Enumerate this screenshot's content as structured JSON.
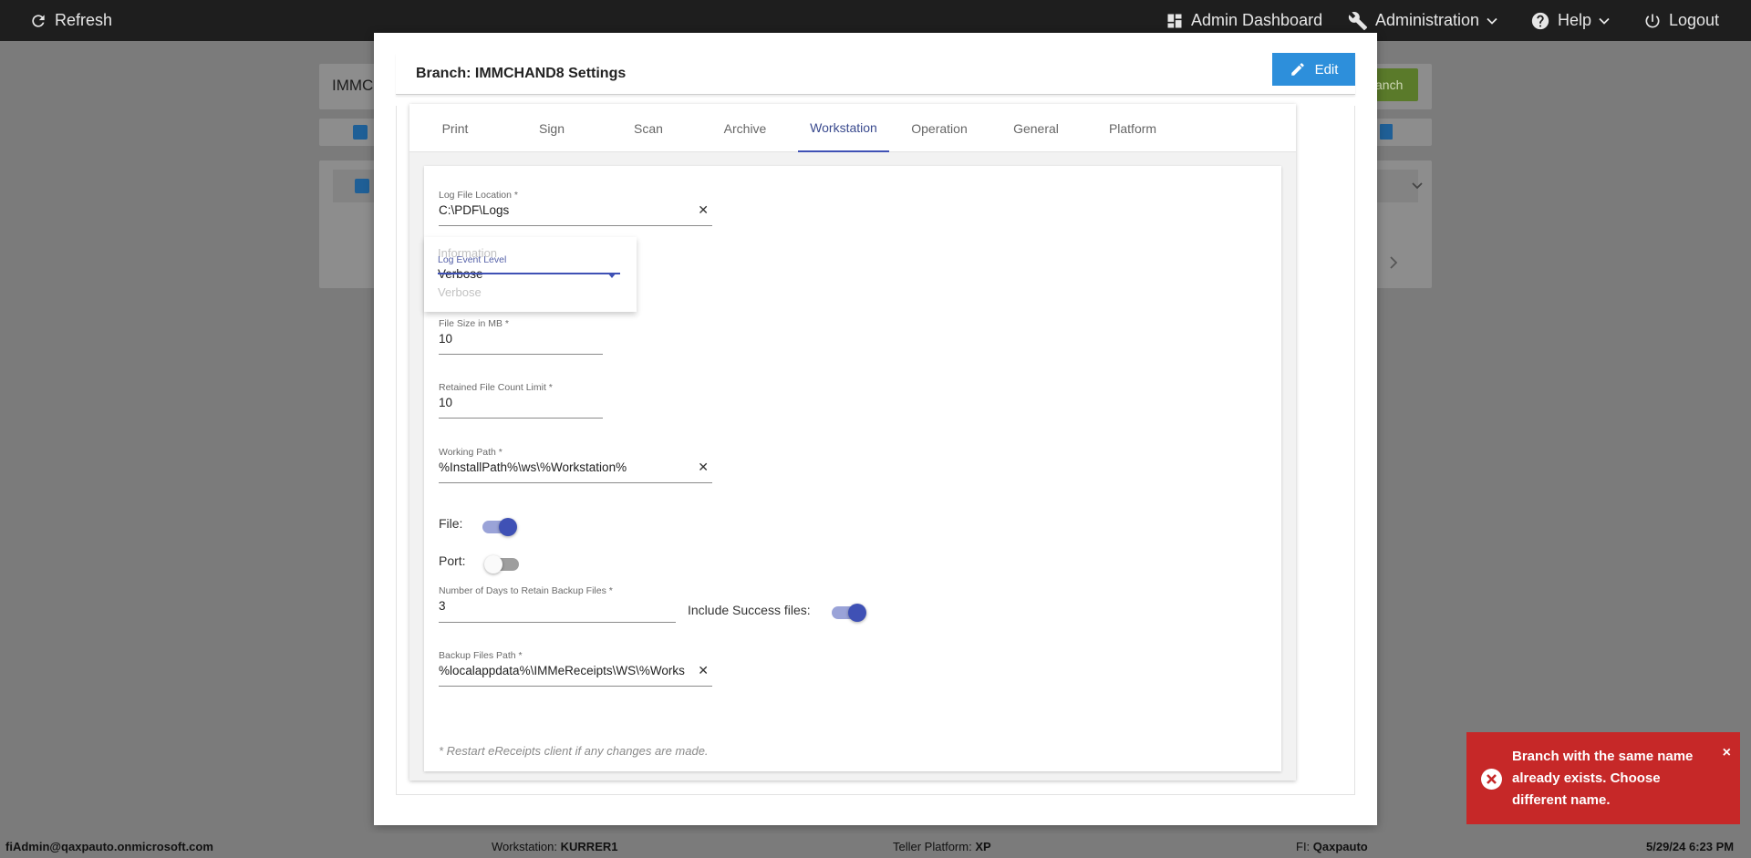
{
  "topbar": {
    "refresh": "Refresh",
    "admin_dashboard": "Admin Dashboard",
    "administration": "Administration",
    "help": "Help",
    "logout": "Logout"
  },
  "background": {
    "search_value": "IMMC",
    "add_button_partial": "anch"
  },
  "modal": {
    "title": "Branch: IMMCHAND8 Settings",
    "edit_label": "Edit",
    "tabs": [
      {
        "label": "Print"
      },
      {
        "label": "Sign"
      },
      {
        "label": "Scan"
      },
      {
        "label": "Archive"
      },
      {
        "label": "Workstation",
        "active": true
      },
      {
        "label": "Operation"
      },
      {
        "label": "General"
      },
      {
        "label": "Platform"
      }
    ],
    "form": {
      "log_file_location": {
        "label": "Log File Location *",
        "value": "C:\\PDF\\Logs"
      },
      "log_event_level": {
        "label": "Log Event Level",
        "value": "Verbose",
        "options": [
          "Information",
          "Verbose"
        ]
      },
      "file_size": {
        "label": "File Size in MB *",
        "value": "10"
      },
      "retained_count": {
        "label": "Retained File Count Limit *",
        "value": "10"
      },
      "working_path": {
        "label": "Working Path *",
        "value": "%InstallPath%\\ws\\%Workstation%"
      },
      "file_toggle": {
        "label": "File:",
        "on": true
      },
      "port_toggle": {
        "label": "Port:",
        "on": false
      },
      "backup_days": {
        "label": "Number of Days to Retain Backup Files *",
        "value": "3"
      },
      "include_success": {
        "label": "Include Success files:",
        "on": true
      },
      "backup_path": {
        "label": "Backup Files Path *",
        "value": "%localappdata%\\IMMeReceipts\\WS\\%Works"
      },
      "note": "* Restart eReceipts client if any changes are made."
    }
  },
  "toast": {
    "message": "Branch with the same name already exists. Choose different name.",
    "close": "×",
    "color": "#c62828"
  },
  "statusbar": {
    "user": "fiAdmin@qaxpauto.onmicrosoft.com",
    "workstation_label": "Workstation:",
    "workstation_value": "KURRER1",
    "teller_label": "Teller Platform:",
    "teller_value": "XP",
    "fi_label": "FI:",
    "fi_value": "Qaxpauto",
    "datetime": "5/29/24 6:23 PM"
  },
  "colors": {
    "accent": "#3f51b5",
    "edit_button": "#2d8fdb"
  }
}
